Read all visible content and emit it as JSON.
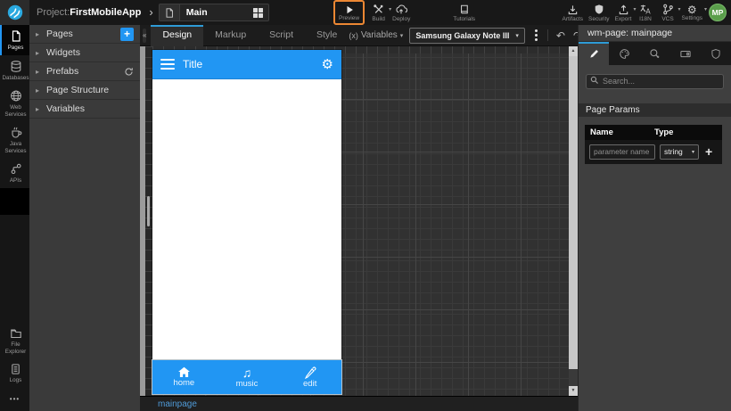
{
  "colors": {
    "accent": "#2196f3",
    "preview_highlight": "#ec8733",
    "avatar_bg": "#5a9e4b"
  },
  "topbar": {
    "project_label": "Project:",
    "project_name": "FirstMobileApp",
    "page_name": "Main",
    "preview": "Preview",
    "build": "Build",
    "deploy": "Deploy",
    "tutorials": "Tutorials",
    "artifacts": "Artifacts",
    "security": "Security",
    "export": "Export",
    "i18n": "I18N",
    "vcs": "VCS",
    "settings": "Settings",
    "avatar_initials": "MP"
  },
  "rail": {
    "pages": "Pages",
    "databases": "Databases",
    "web_services": "Web Services",
    "java_services": "Java Services",
    "apis": "APIs",
    "file_explorer": "File Explorer",
    "logs": "Logs"
  },
  "explorer": {
    "pages": "Pages",
    "widgets": "Widgets",
    "prefabs": "Prefabs",
    "page_structure": "Page Structure",
    "variables": "Variables"
  },
  "canvas": {
    "tab_design": "Design",
    "tab_markup": "Markup",
    "tab_script": "Script",
    "tab_style": "Style",
    "variables_prefix": "(x)",
    "variables_label": "Variables",
    "device_name": "Samsung Galaxy Note III",
    "footer_tab": "mainpage"
  },
  "phone": {
    "title": "Title",
    "nav_home": "home",
    "nav_music": "music",
    "nav_edit": "edit"
  },
  "inspector": {
    "title": "wm-page: mainpage",
    "search_placeholder": "Search...",
    "section_title": "Page Params",
    "col_name": "Name",
    "col_type": "Type",
    "param_placeholder": "parameter name",
    "type_value": "string"
  }
}
